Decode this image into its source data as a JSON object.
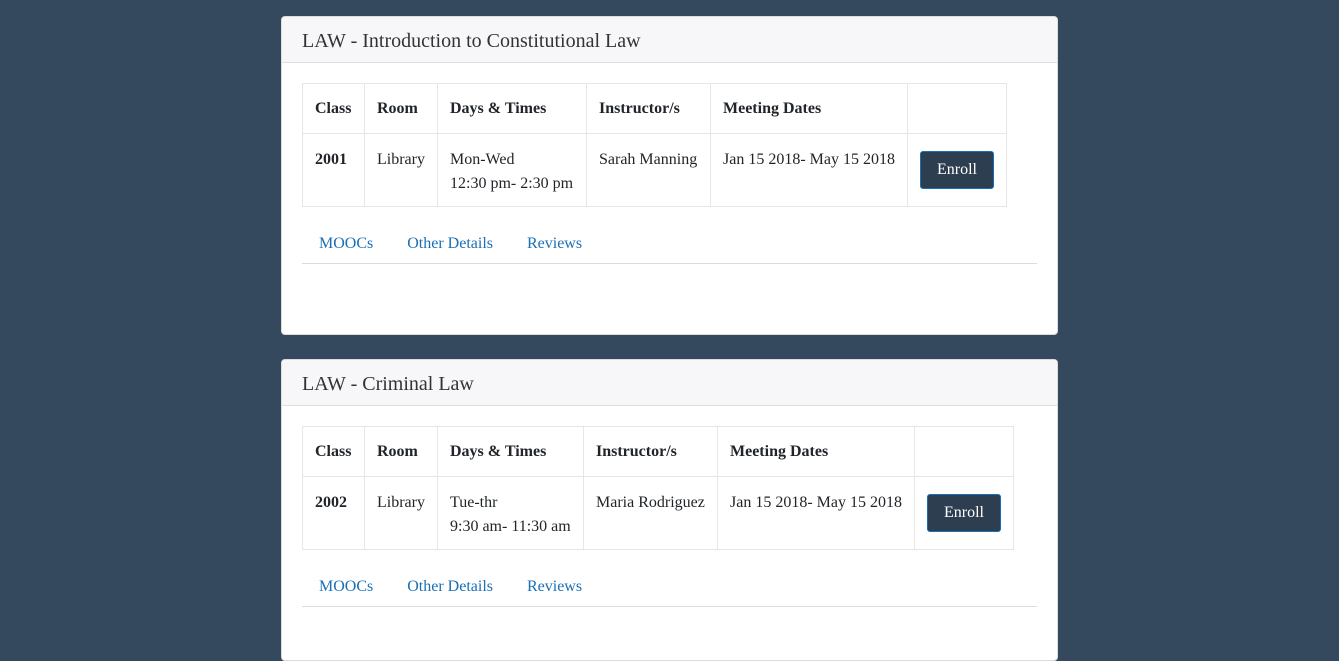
{
  "courses": [
    {
      "title": "LAW - Introduction to Constitutional Law",
      "headers": [
        "Class",
        "Room",
        "Days & Times",
        "Instructor/s",
        "Meeting Dates",
        ""
      ],
      "class_num": "2001",
      "room": "Library",
      "days": "Mon-Wed",
      "times": "12:30 pm- 2:30 pm",
      "instructor": "Sarah Manning",
      "dates": "Jan 15 2018- May 15 2018",
      "enroll_label": "Enroll",
      "tabs": [
        "MOOCs",
        "Other Details",
        "Reviews"
      ]
    },
    {
      "title": "LAW - Criminal Law",
      "headers": [
        "Class",
        "Room",
        "Days & Times",
        "Instructor/s",
        "Meeting Dates",
        ""
      ],
      "class_num": "2002",
      "room": "Library",
      "days": "Tue-thr",
      "times": "9:30 am- 11:30 am",
      "instructor": "Maria Rodriguez",
      "dates": "Jan 15 2018- May 15 2018",
      "enroll_label": "Enroll",
      "tabs": [
        "MOOCs",
        "Other Details",
        "Reviews"
      ]
    }
  ],
  "colors": {
    "page_background": "#34495e",
    "button_background": "#2c3e50",
    "link": "#1a6fb5"
  }
}
